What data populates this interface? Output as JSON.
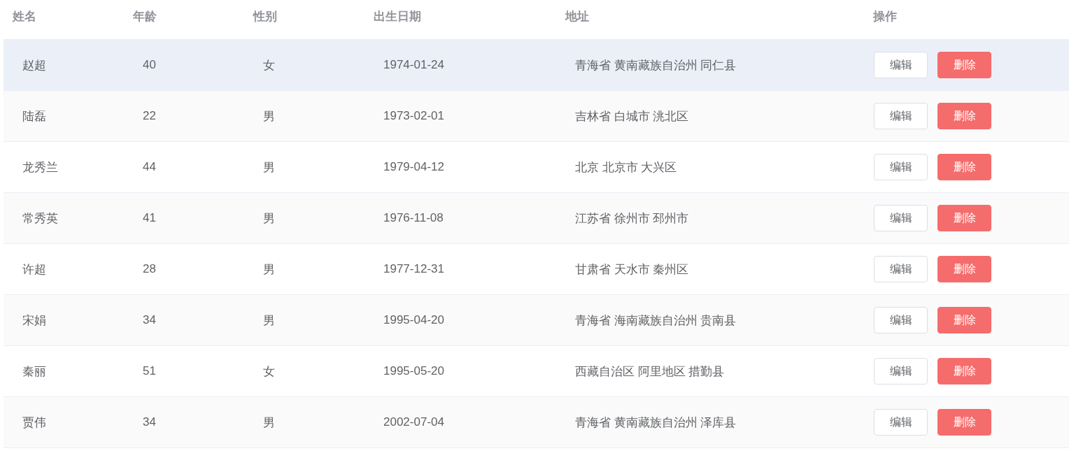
{
  "table": {
    "columns": [
      "姓名",
      "年龄",
      "性别",
      "出生日期",
      "地址",
      "操作"
    ],
    "rows": [
      {
        "name": "赵超",
        "age": "40",
        "gender": "女",
        "birth": "1974-01-24",
        "address": "青海省 黄南藏族自治州 同仁县",
        "hovered": true,
        "actions": [
          "编辑",
          "删除"
        ]
      },
      {
        "name": "陆磊",
        "age": "22",
        "gender": "男",
        "birth": "1973-02-01",
        "address": "吉林省 白城市 洮北区",
        "hovered": false,
        "actions": [
          "编辑",
          "删除"
        ]
      },
      {
        "name": "龙秀兰",
        "age": "44",
        "gender": "男",
        "birth": "1979-04-12",
        "address": "北京 北京市 大兴区",
        "hovered": false,
        "actions": [
          "编辑",
          "删除"
        ]
      },
      {
        "name": "常秀英",
        "age": "41",
        "gender": "男",
        "birth": "1976-11-08",
        "address": "江苏省 徐州市 邳州市",
        "hovered": false,
        "actions": [
          "编辑",
          "删除"
        ]
      },
      {
        "name": "许超",
        "age": "28",
        "gender": "男",
        "birth": "1977-12-31",
        "address": "甘肃省 天水市 秦州区",
        "hovered": false,
        "actions": [
          "编辑",
          "删除"
        ]
      },
      {
        "name": "宋娟",
        "age": "34",
        "gender": "男",
        "birth": "1995-04-20",
        "address": "青海省 海南藏族自治州 贵南县",
        "hovered": false,
        "actions": [
          "编辑",
          "删除"
        ]
      },
      {
        "name": "秦丽",
        "age": "51",
        "gender": "女",
        "birth": "1995-05-20",
        "address": "西藏自治区 阿里地区 措勤县",
        "hovered": false,
        "actions": [
          "编辑",
          "删除"
        ]
      },
      {
        "name": "贾伟",
        "age": "34",
        "gender": "男",
        "birth": "2002-07-04",
        "address": "青海省 黄南藏族自治州 泽库县",
        "hovered": false,
        "actions": [
          "编辑",
          "删除"
        ]
      }
    ]
  }
}
